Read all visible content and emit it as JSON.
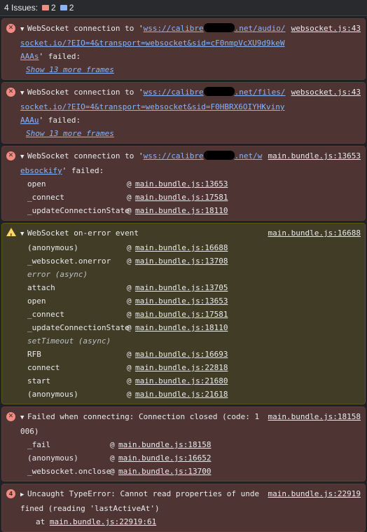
{
  "issues_bar": {
    "label": "4 Issues:",
    "errors": "2",
    "info": "2"
  },
  "colors": {
    "error_bg": "#4e3534",
    "warning_bg": "#413c26",
    "link": "#8ab4f8"
  },
  "messages": [
    {
      "level": "error",
      "text_prefix": "WebSocket connection to '",
      "url_a": "wss://calibre",
      "url_b": ".net/audio/socket.io/?EIO=4&transport=websocket&sid=cF0nmpVcXU9d9keWAAAs",
      "text_suffix": "' failed:",
      "source": "websocket.js:43",
      "more": "Show 13 more frames"
    },
    {
      "level": "error",
      "text_prefix": "WebSocket connection to '",
      "url_a": "wss://calibre",
      "url_b": ".net/files/socket.io/?EIO=4&transport=websocket&sid=F0HBRX6OIYHKvinyAAAu",
      "text_suffix": "' failed:",
      "source": "websocket.js:43",
      "more": "Show 13 more frames"
    },
    {
      "level": "error",
      "text_prefix": "WebSocket connection to '",
      "url_a": "wss://calibre",
      "url_b": ".net/websockify",
      "text_suffix": "' failed:",
      "source": "main.bundle.js:13653",
      "frames": [
        {
          "fn": "open",
          "loc": "main.bundle.js:13653"
        },
        {
          "fn": "_connect",
          "loc": "main.bundle.js:17581"
        },
        {
          "fn": "_updateConnectionState",
          "loc": "main.bundle.js:18110"
        }
      ]
    },
    {
      "level": "warning",
      "text": "WebSocket on-error event",
      "source": "main.bundle.js:16688",
      "frames": [
        {
          "fn": "(anonymous)",
          "loc": "main.bundle.js:16688"
        },
        {
          "fn": "_websocket.onerror",
          "loc": "main.bundle.js:13708"
        },
        {
          "async": "error (async)"
        },
        {
          "fn": "attach",
          "loc": "main.bundle.js:13705"
        },
        {
          "fn": "open",
          "loc": "main.bundle.js:13653"
        },
        {
          "fn": "_connect",
          "loc": "main.bundle.js:17581"
        },
        {
          "fn": "_updateConnectionState",
          "loc": "main.bundle.js:18110"
        },
        {
          "async": "setTimeout (async)"
        },
        {
          "fn": "RFB",
          "loc": "main.bundle.js:16693"
        },
        {
          "fn": "connect",
          "loc": "main.bundle.js:22818"
        },
        {
          "fn": "start",
          "loc": "main.bundle.js:21680"
        },
        {
          "fn": "(anonymous)",
          "loc": "main.bundle.js:21618"
        }
      ]
    },
    {
      "level": "error",
      "text": "Failed when connecting: Connection closed (code: 1006)",
      "source": "main.bundle.js:18158",
      "frames": [
        {
          "fn": "_fail",
          "loc": "main.bundle.js:18158"
        },
        {
          "fn": "(anonymous)",
          "loc": "main.bundle.js:16652"
        },
        {
          "fn": "_websocket.onclose",
          "loc": "main.bundle.js:13700"
        }
      ]
    },
    {
      "level": "error",
      "count": "4",
      "text": "Uncaught TypeError: Cannot read properties of undefined (reading 'lastActiveAt')",
      "source": "main.bundle.js:22919",
      "at_label": "at",
      "at_loc": "main.bundle.js:22919:61"
    }
  ]
}
